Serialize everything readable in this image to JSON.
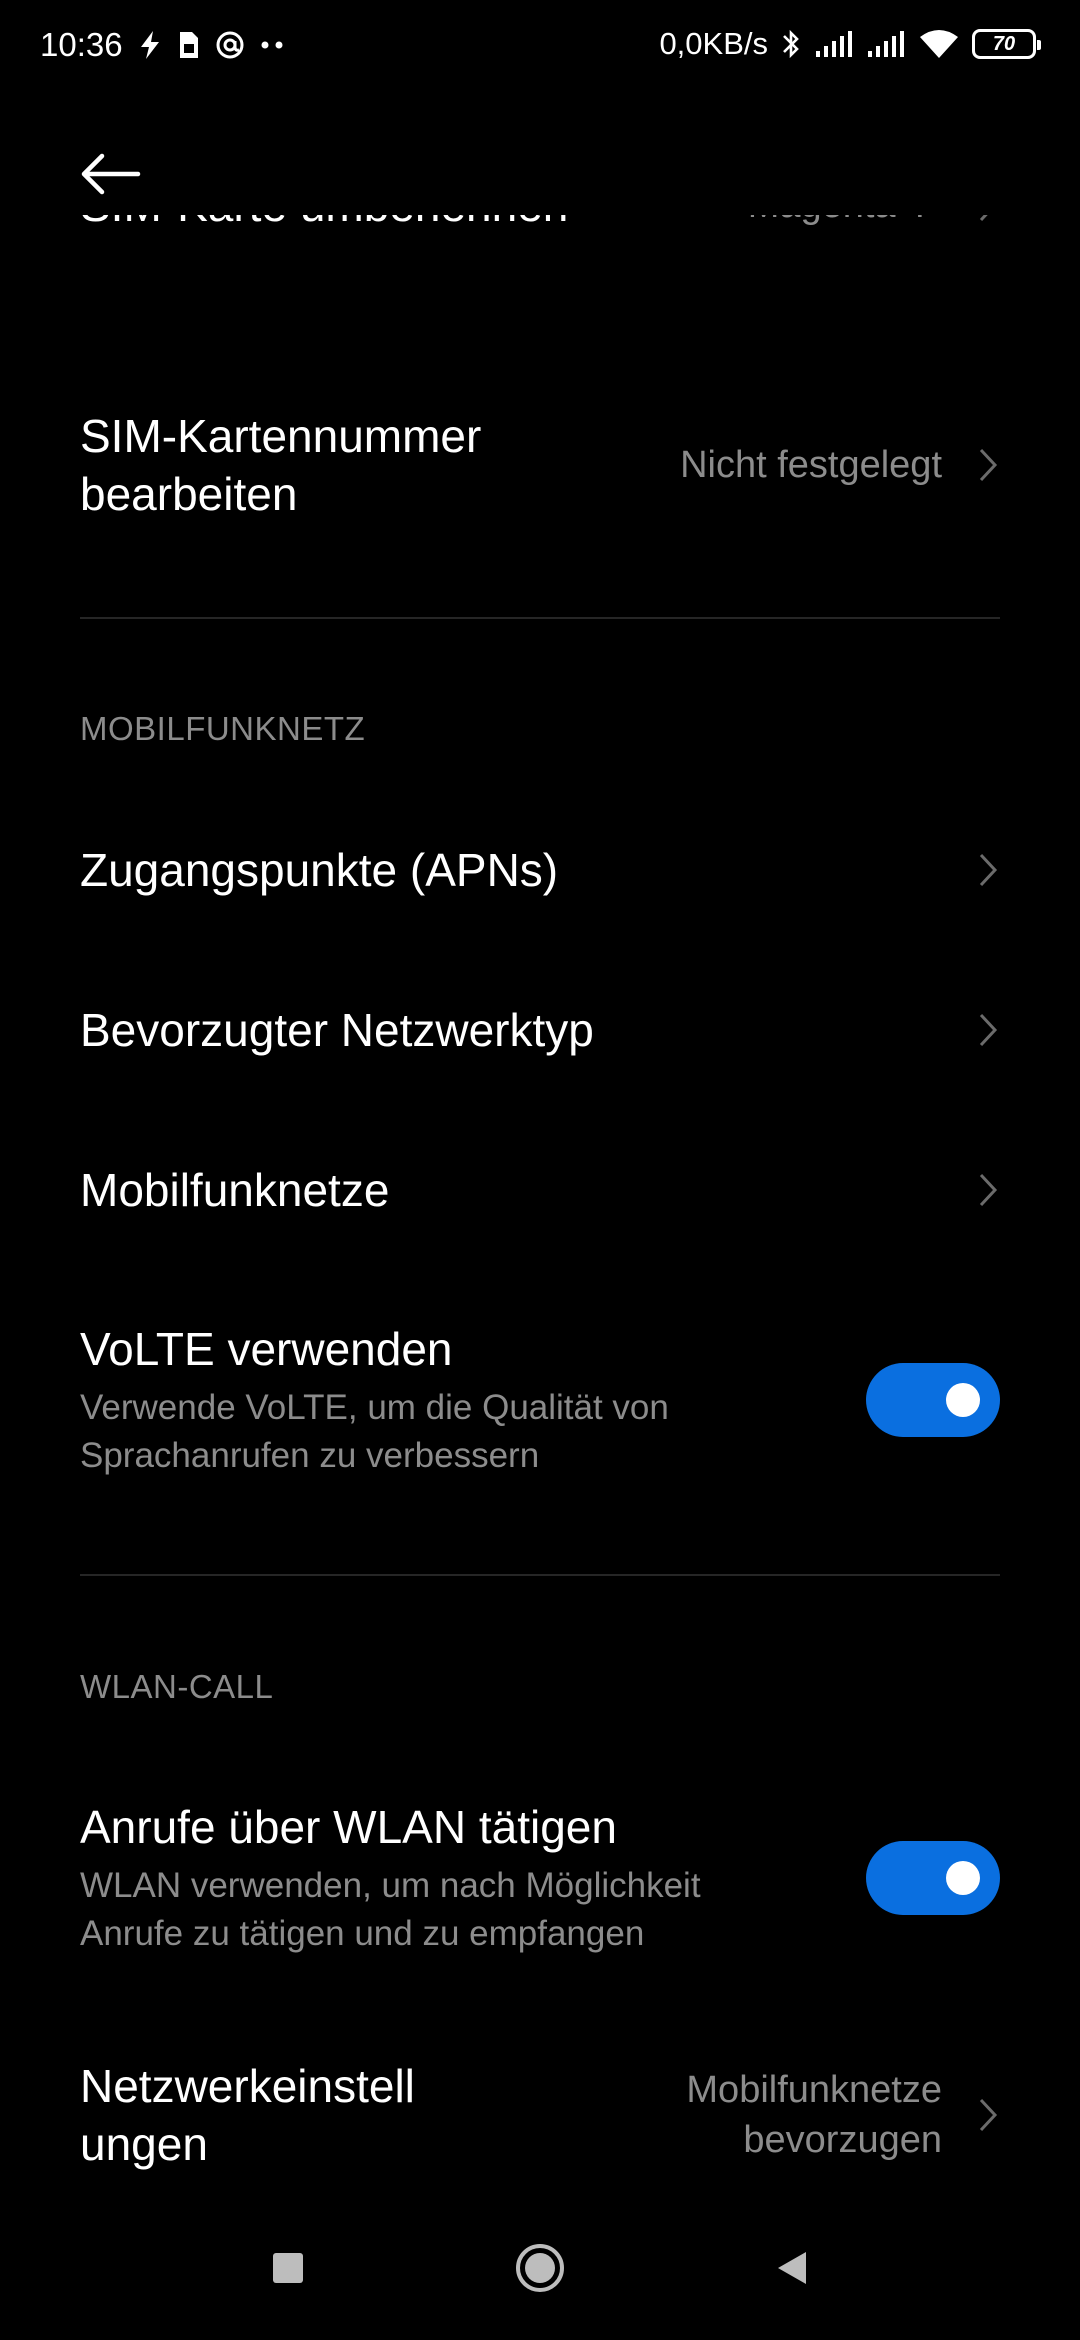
{
  "status_bar": {
    "time": "10:36",
    "net_speed": "0,0KB/s",
    "battery": "70",
    "icons": [
      "flash-icon",
      "sim-icon",
      "at-sign-icon",
      "more-dots-icon",
      "bluetooth-icon",
      "signal-icon",
      "signal-icon",
      "wifi-icon",
      "battery-icon"
    ]
  },
  "header": {
    "back_icon": "arrow-left-icon"
  },
  "list": {
    "rename_sim": {
      "title": "SIM-Karte umbenennen",
      "value": "Magenta-T-"
    },
    "edit_number": {
      "title_line1": "SIM-Kartennummer",
      "title_line2": "bearbeiten",
      "value": "Nicht festgelegt"
    },
    "section_mobile": "MOBILFUNKNETZ",
    "apns": {
      "title": "Zugangspunkte (APNs)"
    },
    "network_type": {
      "title": "Bevorzugter Netzwerktyp"
    },
    "mobile_networks": {
      "title": "Mobilfunknetze"
    },
    "volte": {
      "title": "VoLTE verwenden",
      "sub_line1": "Verwende VoLTE, um die Qualität von",
      "sub_line2": "Sprachanrufen zu verbessern",
      "enabled": true
    },
    "section_wifi_call": "WLAN-CALL",
    "wifi_calling": {
      "title": "Anrufe über WLAN tätigen",
      "sub_line1": "WLAN verwenden, um nach Möglichkeit",
      "sub_line2": "Anrufe zu tätigen und zu empfangen",
      "enabled": true
    },
    "network_settings": {
      "title_line1": "Netzwerkeinstell",
      "title_line2": "ungen",
      "value_line1": "Mobilfunknetze",
      "value_line2": "bevorzugen"
    }
  },
  "colors": {
    "accent": "#0a6fe0",
    "background": "#000000",
    "secondary_text": "#8c8c8c"
  },
  "nav_bar": {
    "icons": [
      "recents-square-icon",
      "home-circle-icon",
      "back-triangle-icon"
    ]
  }
}
